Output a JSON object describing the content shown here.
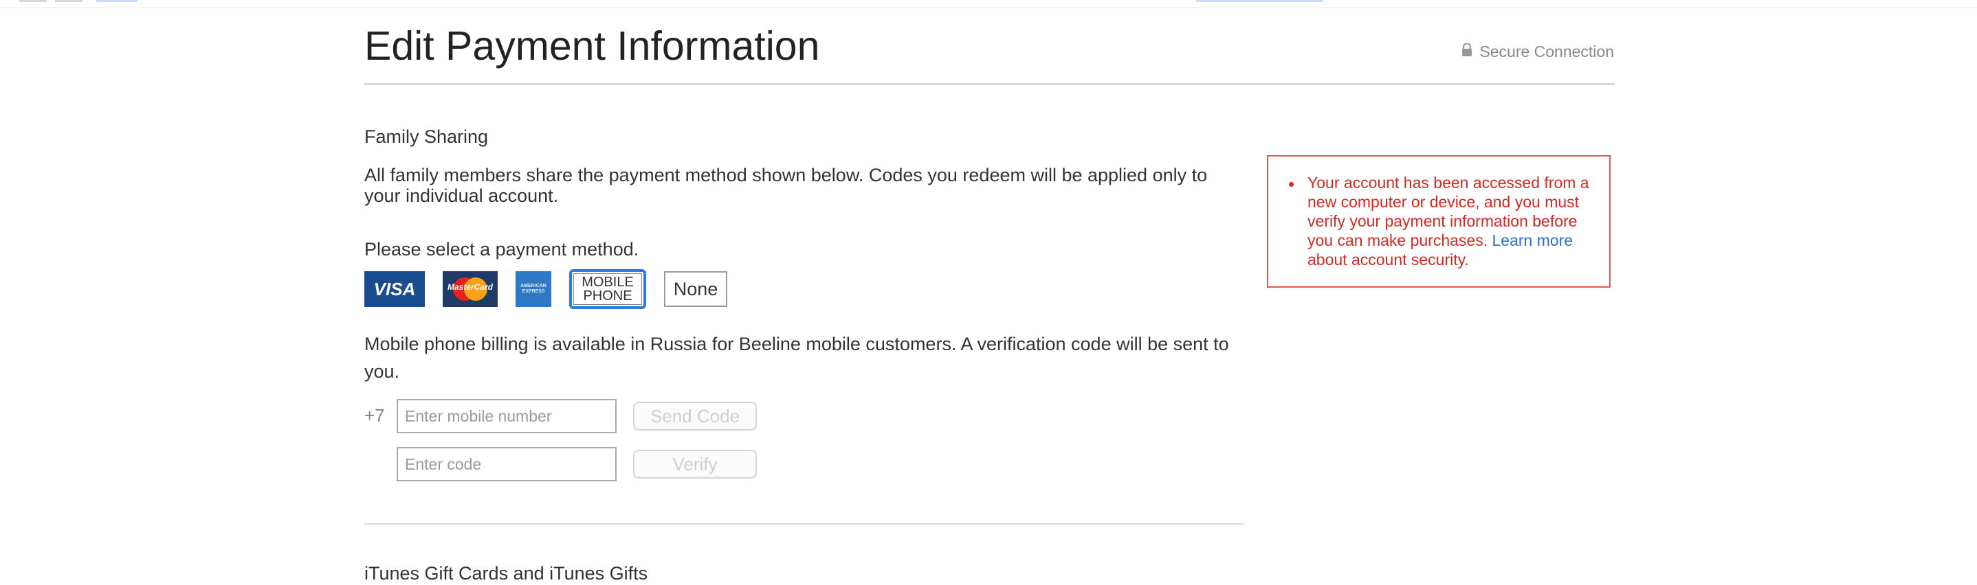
{
  "header": {
    "title": "Edit Payment Information",
    "secure_label": "Secure Connection"
  },
  "family_sharing": {
    "label": "Family Sharing",
    "description": "All family members share the payment method shown below. Codes you redeem will be applied only to your individual account."
  },
  "payment": {
    "prompt": "Please select a payment method.",
    "methods": {
      "visa": "VISA",
      "mastercard": "MasterCard",
      "amex_line1": "AMERICAN",
      "amex_line2": "EXPRESS",
      "mobile_line1": "MOBILE",
      "mobile_line2": "PHONE",
      "none": "None"
    },
    "selected": "mobile_phone"
  },
  "mobile_billing": {
    "info": "Mobile phone billing is available in Russia for Beeline mobile customers. A verification code will be sent to you.",
    "country_code": "+7",
    "phone_placeholder": "Enter mobile number",
    "phone_value": "",
    "code_placeholder": "Enter code",
    "code_value": "",
    "send_code_label": "Send Code",
    "verify_label": "Verify"
  },
  "gift_cards": {
    "heading": "iTunes Gift Cards and iTunes Gifts"
  },
  "alert": {
    "message": "Your account has been accessed from a new computer or device, and you must verify your payment information before you can make purchases.",
    "link_text": "Learn more",
    "link_suffix": " about account security."
  },
  "colors": {
    "accent": "#2b7be0",
    "alert_red": "#d62a20",
    "link_blue": "#2c6fce",
    "visa_blue": "#1a4d8f"
  }
}
